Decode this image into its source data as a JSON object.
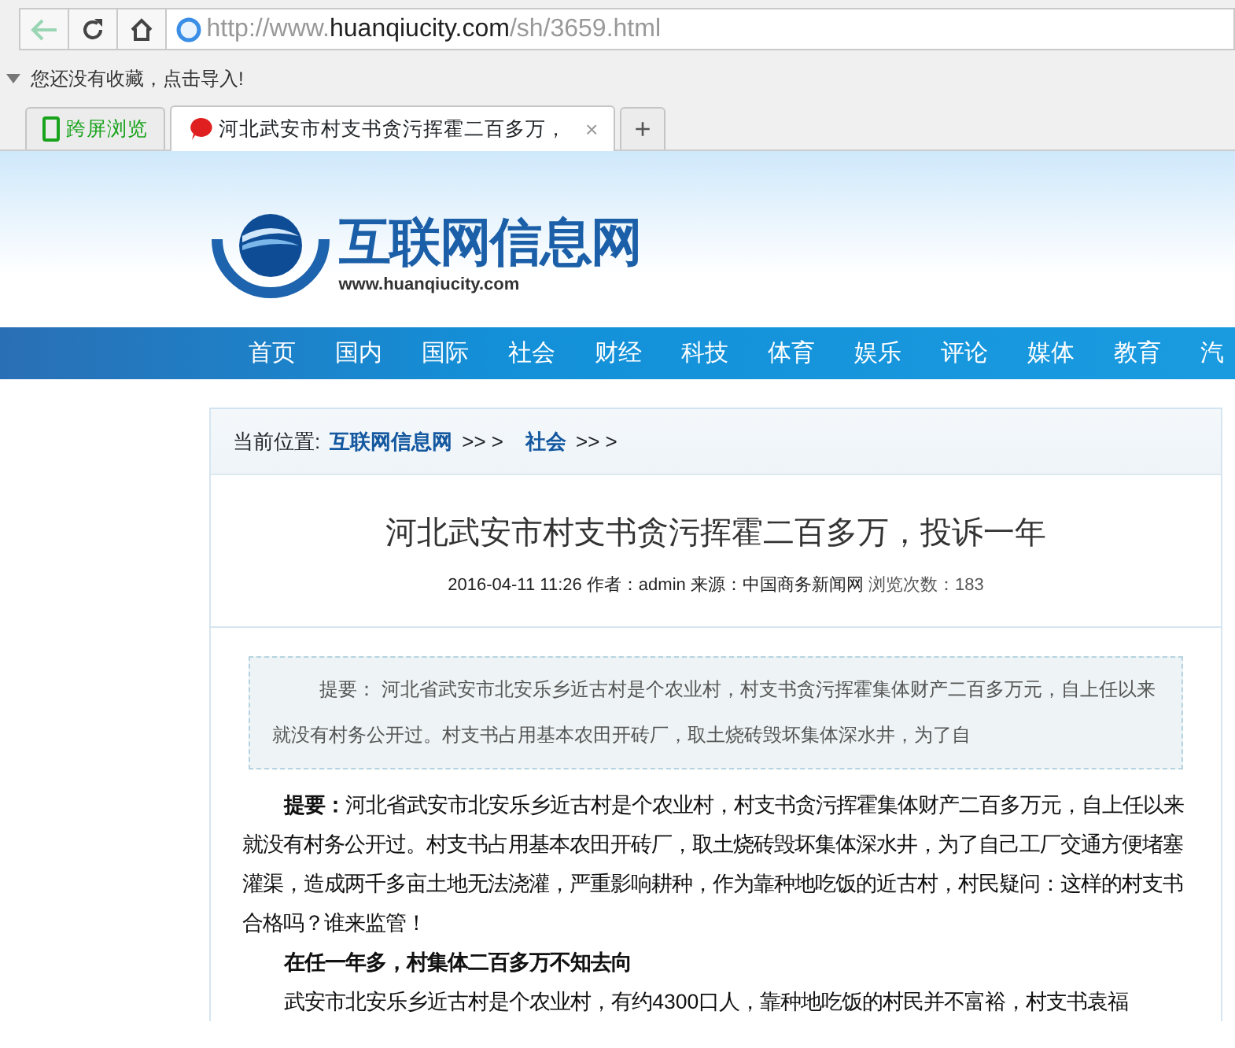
{
  "browser": {
    "url": {
      "prefix": "http://www.",
      "host": "huanqiucity.com",
      "path": "/sh/3659.html"
    },
    "back_disabled": true,
    "bookmarks_hint": "您还没有收藏，点击导入!",
    "tabs": [
      {
        "label": "跨屏浏览",
        "selected": false,
        "kind": "phone"
      },
      {
        "label": "河北武安市村支书贪污挥霍二百多万，",
        "selected": true,
        "kind": "site"
      }
    ],
    "new_tab": "+",
    "close": "×"
  },
  "site": {
    "name": "互联网信息网",
    "domain": "www.huanqiucity.com",
    "nav": [
      "首页",
      "国内",
      "国际",
      "社会",
      "财经",
      "科技",
      "体育",
      "娱乐",
      "评论",
      "媒体",
      "教育",
      "汽"
    ]
  },
  "breadcrumb": {
    "label": "当前位置:",
    "items": [
      {
        "text": "互联网信息网",
        "sep": ">> >"
      },
      {
        "text": "社会",
        "sep": ">> >"
      }
    ]
  },
  "article": {
    "title": "河北武安市村支书贪污挥霍二百多万，投诉一年",
    "meta": "2016-04-11 11:26 作者：admin 来源：中国商务新闻网",
    "views": "浏览次数：183",
    "summary": "提要：  河北省武安市北安乐乡近古村是个农业村，村支书贪污挥霍集体财产二百多万元，自上任以来就没有村务公开过。村支书占用基本农田开砖厂，取土烧砖毁坏集体深水井，为了自",
    "body": [
      {
        "kind": "paragraph",
        "text": "**提要：**河北省武安市北安乐乡近古村是个农业村，村支书贪污挥霍集体财产二百多万元，自上任以来就没有村务公开过。村支书占用基本农田开砖厂，取土烧砖毁坏集体深水井，为了自己工厂交通方便堵塞灌渠，造成两千多亩土地无法浇灌，严重影响耕种，作为靠种地吃饭的近古村，村民疑问：这样的村支书合格吗？谁来监管！"
      },
      {
        "kind": "heading",
        "text": "在任一年多，村集体二百多万不知去向"
      },
      {
        "kind": "paragraph",
        "text": "武安市北安乐乡近古村是个农业村，有约4300口人，靠种地吃饭的村民并不富裕，村支书袁福"
      }
    ]
  }
}
